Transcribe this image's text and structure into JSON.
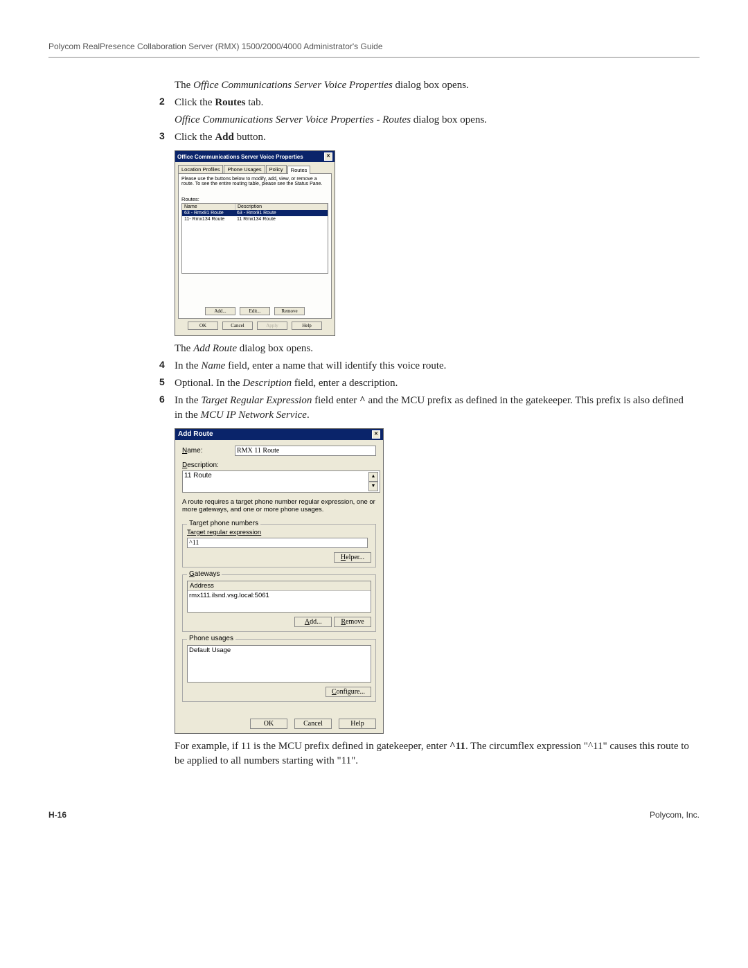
{
  "header": "Polycom RealPresence Collaboration Server (RMX) 1500/2000/4000 Administrator's Guide",
  "intro_line": {
    "pre": "The ",
    "em": "Office Communications Server Voice Properties",
    "post": " dialog box opens."
  },
  "step2": {
    "num": "2",
    "pre": "Click the ",
    "b": "Routes",
    "post": " tab."
  },
  "step2b": {
    "em": "Office Communications Server Voice Properties - Routes",
    "post": " dialog box opens."
  },
  "step3": {
    "num": "3",
    "pre": "Click the ",
    "b": "Add",
    "post": " button."
  },
  "dialog1": {
    "title": "Office Communications Server Voice Properties",
    "tabs": [
      "Location Profiles",
      "Phone Usages",
      "Policy",
      "Routes"
    ],
    "instr": "Please use the buttons below to modify, add, view, or remove a route. To see the entire routing table, please see the Status Pane.",
    "routes_label": "Routes:",
    "cols": {
      "name": "Name",
      "desc": "Description"
    },
    "rows": [
      {
        "name": "63 - Rmx91 Route",
        "desc": "63 - Rmx91 Route"
      },
      {
        "name": "11- Rmx134 Route",
        "desc": "11 Rmx134 Route"
      }
    ],
    "btns_a": {
      "add": "Add...",
      "edit": "Edit...",
      "remove": "Remove"
    },
    "btns_b": {
      "ok": "OK",
      "cancel": "Cancel",
      "apply": "Apply",
      "help": "Help"
    }
  },
  "after_d1": {
    "pre": "The ",
    "em": "Add Route",
    "post": " dialog box opens."
  },
  "step4": {
    "num": "4",
    "pre": "In the ",
    "em": "Name",
    "post": " field, enter a name that will identify this voice route."
  },
  "step5": {
    "num": "5",
    "pre": "Optional. In the ",
    "em": "Description",
    "post": " field, enter a description."
  },
  "step6": {
    "num": "6",
    "pre": "In the ",
    "em": "Target Regular Expression",
    "mid": " field enter ",
    "b1": "^",
    "mid2": " and the MCU prefix as defined in the gatekeeper. This prefix is also defined in the ",
    "em2": "MCU IP Network Service",
    "post": "."
  },
  "dialog2": {
    "title": "Add Route",
    "name_label": "Name:",
    "name_value": "RMX 11 Route",
    "desc_label": "Description:",
    "desc_value": "11 Route",
    "note": "A route requires a target phone number regular expression, one or more gateways, and one or more phone usages.",
    "target_fs": "Target phone numbers",
    "target_sub": "Target regular expression",
    "target_val": "^11",
    "helper": "Helper...",
    "gw_fs": "Gateways",
    "gw_col": "Address",
    "gw_val": "rmx111.ilsnd.vsg.local:5061",
    "gw_add": "Add...",
    "gw_rem": "Remove",
    "pu_fs": "Phone usages",
    "pu_val": "Default Usage",
    "pu_cfg": "Configure...",
    "ok": "OK",
    "cancel": "Cancel",
    "help": "Help"
  },
  "after_d2": {
    "pre": "For example, if 11 is the MCU prefix defined in gatekeeper, enter ",
    "b": "^11",
    "post": ". The circumflex expression \"^11\" causes this route to be applied to all numbers starting with \"11\"."
  },
  "footer": {
    "left": "H-16",
    "right": "Polycom, Inc."
  }
}
